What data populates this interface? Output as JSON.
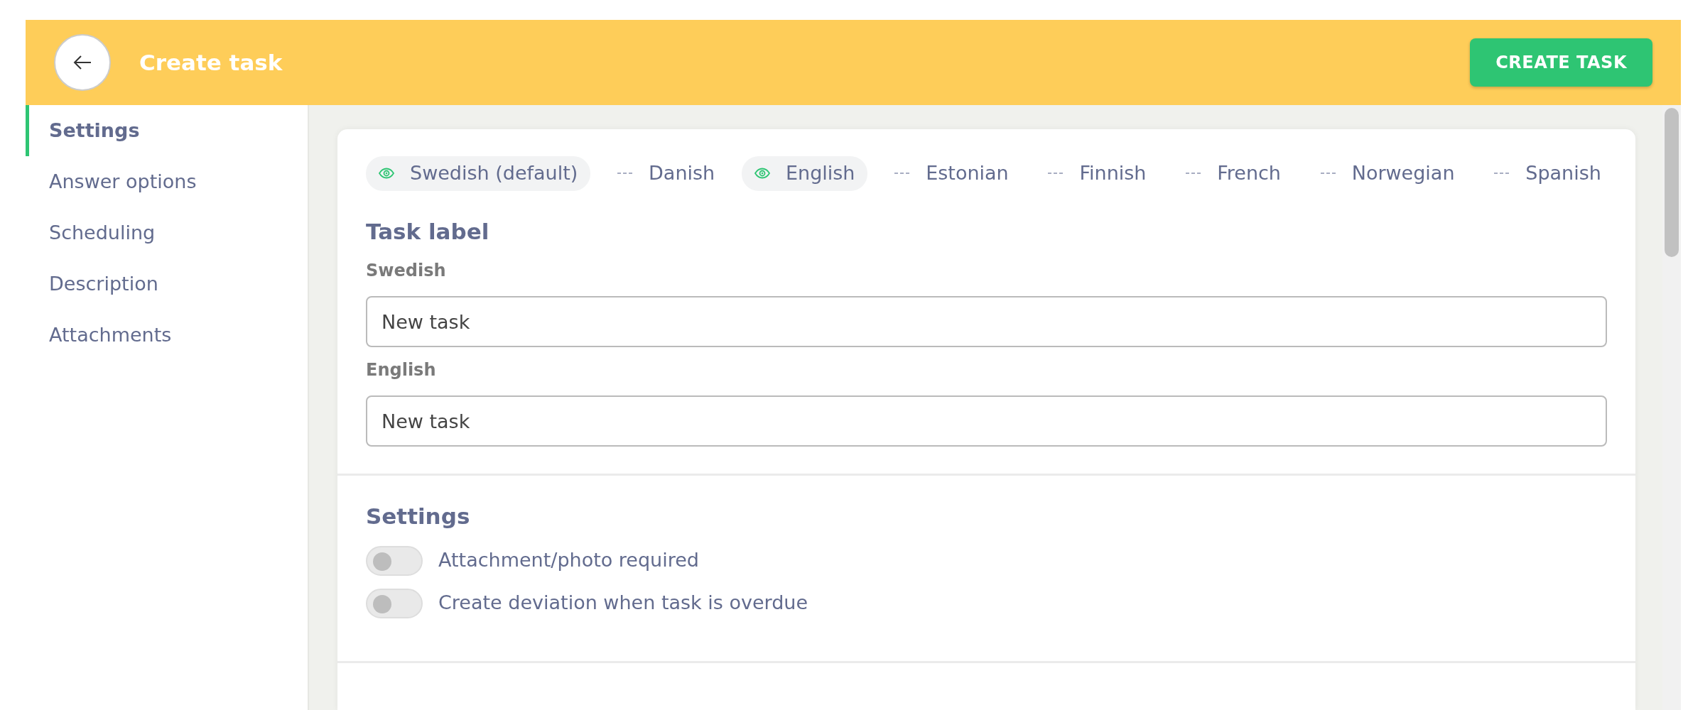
{
  "header": {
    "title": "Create task",
    "action": "CREATE TASK"
  },
  "sidebar": {
    "items": [
      {
        "label": "Settings",
        "selected": true
      },
      {
        "label": "Answer options",
        "selected": false
      },
      {
        "label": "Scheduling",
        "selected": false
      },
      {
        "label": "Description",
        "selected": false
      },
      {
        "label": "Attachments",
        "selected": false
      }
    ]
  },
  "languages": [
    {
      "label": "Swedish (default)",
      "visible": true
    },
    {
      "label": "Danish",
      "visible": false
    },
    {
      "label": "English",
      "visible": true
    },
    {
      "label": "Estonian",
      "visible": false
    },
    {
      "label": "Finnish",
      "visible": false
    },
    {
      "label": "French",
      "visible": false
    },
    {
      "label": "Norwegian",
      "visible": false
    },
    {
      "label": "Spanish",
      "visible": false
    }
  ],
  "task_label": {
    "heading": "Task label",
    "fields": [
      {
        "label": "Swedish",
        "value": "New task"
      },
      {
        "label": "English",
        "value": "New task"
      }
    ]
  },
  "settings": {
    "heading": "Settings",
    "toggles": [
      {
        "label": "Attachment/photo required",
        "on": false
      },
      {
        "label": "Create deviation when task is overdue",
        "on": false
      }
    ]
  }
}
